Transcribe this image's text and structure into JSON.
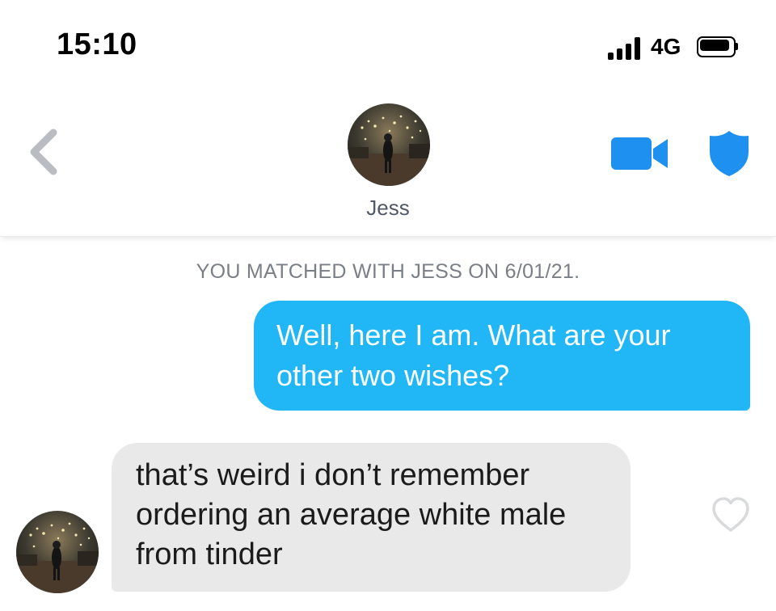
{
  "status_bar": {
    "time": "15:10",
    "network": "4G",
    "signal_icon": "signal-bars-icon",
    "battery_icon": "battery-icon"
  },
  "header": {
    "back_icon": "chevron-left-icon",
    "contact_name": "Jess",
    "video_icon": "video-camera-icon",
    "safety_icon": "shield-icon"
  },
  "conversation": {
    "match_notice": "YOU MATCHED WITH JESS ON 6/01/21.",
    "messages": [
      {
        "direction": "sent",
        "lines": [
          "Well, here I am. What are your",
          "other two wishes?"
        ]
      },
      {
        "direction": "received",
        "lines": [
          "that’s weird i don’t remember",
          "ordering an average white male",
          "from tinder"
        ],
        "like_icon": "heart-outline-icon"
      }
    ]
  },
  "colors": {
    "sent_bubble": "#21b6f5",
    "received_bubble": "#e9e9ea",
    "accent_blue": "#1e90f0",
    "muted_text": "#7a7f87",
    "back_chevron": "#b9bcc0"
  }
}
